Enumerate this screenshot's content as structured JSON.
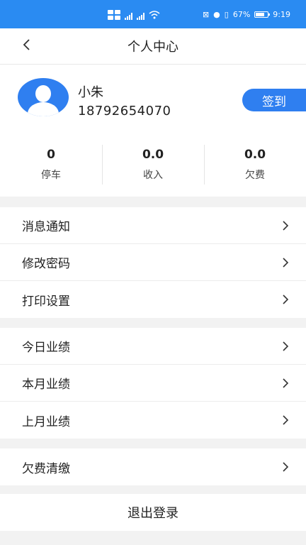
{
  "status_bar": {
    "battery": "67%",
    "time": "9:19",
    "icons": [
      "sim-card-icon",
      "signal-icon",
      "signal-icon",
      "wifi-icon",
      "mute-icon",
      "location-icon",
      "vibrate-icon",
      "battery-icon"
    ]
  },
  "header": {
    "title": "个人中心",
    "back_icon": "chevron-left-icon"
  },
  "profile": {
    "name": "小朱",
    "phone": "18792654070",
    "checkin_label": "签到",
    "avatar_icon": "user-avatar-icon",
    "accent_color": "#2f7ff0"
  },
  "stats": [
    {
      "value": "0",
      "label": "停车"
    },
    {
      "value": "0.0",
      "label": "收入"
    },
    {
      "value": "0.0",
      "label": "欠费"
    }
  ],
  "menu_groups": [
    {
      "items": [
        {
          "label": "消息通知"
        },
        {
          "label": "修改密码"
        },
        {
          "label": "打印设置"
        }
      ]
    },
    {
      "items": [
        {
          "label": "今日业绩"
        },
        {
          "label": "本月业绩"
        },
        {
          "label": "上月业绩"
        }
      ]
    },
    {
      "items": [
        {
          "label": "欠费清缴"
        }
      ]
    }
  ],
  "logout_label": "退出登录"
}
